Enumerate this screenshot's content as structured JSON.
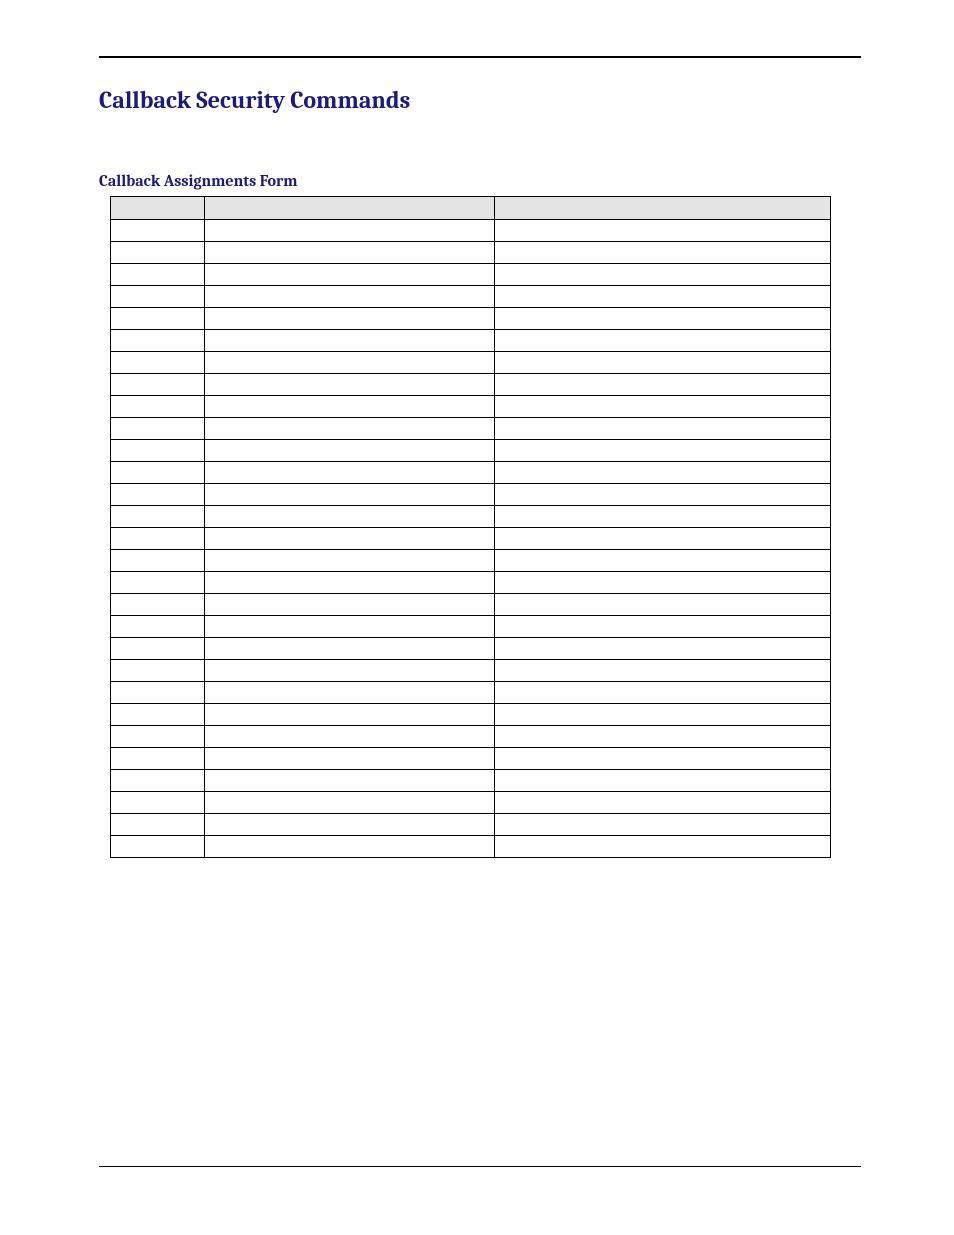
{
  "document": {
    "title": "Callback Security Commands",
    "section_title": "Callback Assignments Form",
    "table": {
      "columns": [
        "",
        "",
        ""
      ],
      "row_count": 29
    }
  }
}
